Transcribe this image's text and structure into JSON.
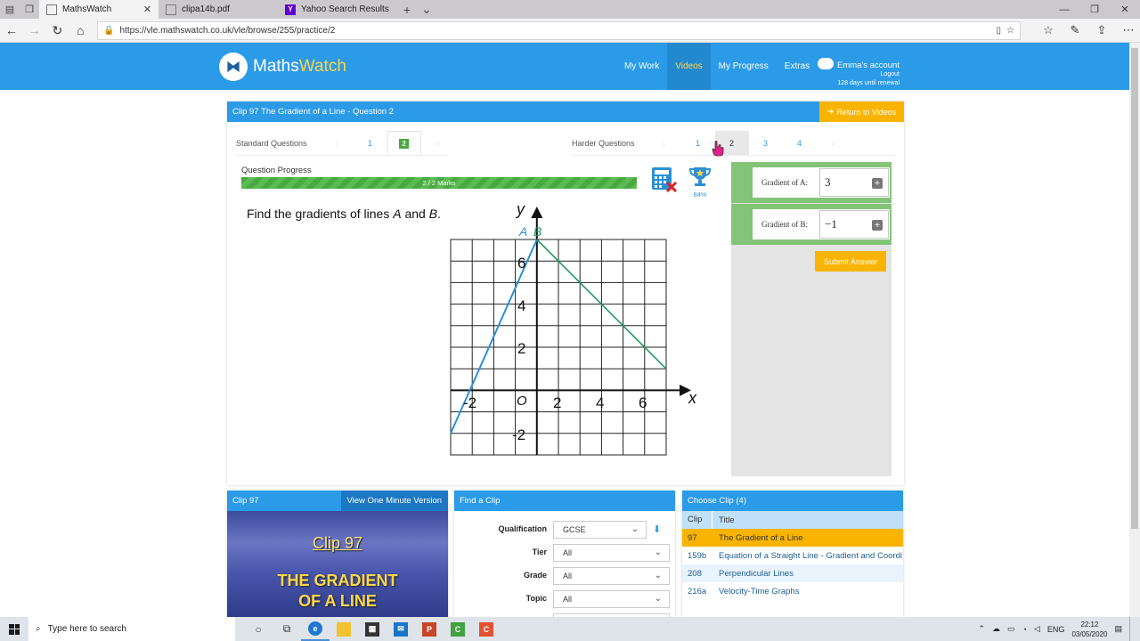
{
  "browser": {
    "tabs": [
      {
        "title": "MathsWatch",
        "active": true
      },
      {
        "title": "clipa14b.pdf",
        "active": false
      },
      {
        "title": "Yahoo Search Results - Web",
        "active": false
      }
    ],
    "url": "https://vle.mathswatch.co.uk/vle/browse/255/practice/2"
  },
  "site": {
    "logo_main": "Maths",
    "logo_accent": "Watch",
    "nav": [
      "My Work",
      "Videos",
      "My Progress",
      "Extras"
    ],
    "active_nav": "Videos",
    "account_name": "Emma's account",
    "logout": "Logout",
    "renewal": "128 days until renewal"
  },
  "question": {
    "header": "Clip 97 The Gradient of a Line - Question 2",
    "return_label": "Return to Videos",
    "standard_label": "Standard Questions",
    "standard_questions": [
      "1",
      "2"
    ],
    "standard_active": "2",
    "harder_label": "Harder Questions",
    "harder_questions": [
      "1",
      "2",
      "3",
      "4"
    ],
    "progress_label": "Question Progress",
    "progress_text": "2 / 2 Marks",
    "progress_fraction": 1.0,
    "trophy_percent": "84%",
    "prompt_pre": "Find the gradients of lines ",
    "prompt_a": "A",
    "prompt_mid": " and ",
    "prompt_b": "B",
    "prompt_post": ".",
    "answers": [
      {
        "label": "Gradient of A:",
        "value": "3"
      },
      {
        "label": "Gradient of B:",
        "value": "−1"
      }
    ],
    "submit_label": "Submit Answer"
  },
  "graph": {
    "x_axis_label": "x",
    "y_axis_label": "y",
    "origin_label": "O",
    "x_ticks": [
      "-2",
      "2",
      "4",
      "6"
    ],
    "y_ticks": [
      "6",
      "4",
      "2",
      "-2"
    ],
    "line_a_label": "A",
    "line_b_label": "B",
    "line_a_color": "#2b8fd6",
    "line_b_color": "#1f9a5a"
  },
  "clip_panel": {
    "header": "Clip 97",
    "button": "View One Minute Version",
    "preview_clip": "Clip 97",
    "preview_title_line1": "THE GRADIENT",
    "preview_title_line2": "OF A LINE"
  },
  "find_panel": {
    "header": "Find a Clip",
    "fields": [
      {
        "label": "Qualification",
        "value": "GCSE"
      },
      {
        "label": "Tier",
        "value": "All"
      },
      {
        "label": "Grade",
        "value": "All"
      },
      {
        "label": "Topic",
        "value": "All"
      }
    ]
  },
  "choose_panel": {
    "header": "Choose Clip (4)",
    "columns": [
      "Clip",
      "Title"
    ],
    "rows": [
      {
        "clip": "97",
        "title": "The Gradient of a Line"
      },
      {
        "clip": "159b",
        "title": "Equation of a Straight Line - Gradient and Coordi"
      },
      {
        "clip": "208",
        "title": "Perpendicular Lines"
      },
      {
        "clip": "216a",
        "title": "Velocity-Time Graphs"
      }
    ]
  },
  "taskbar": {
    "search_placeholder": "Type here to search",
    "language": "ENG",
    "time": "22:12",
    "date": "03/05/2020"
  },
  "colors": {
    "brand_blue": "#2b9be8",
    "accent_orange": "#f8b400",
    "success_green": "#4aa843"
  }
}
